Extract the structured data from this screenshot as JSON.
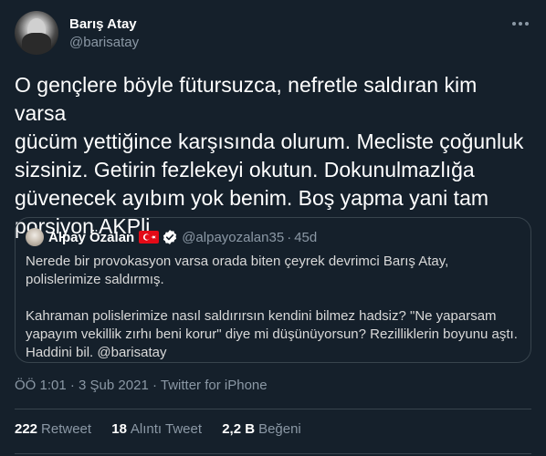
{
  "author": {
    "display_name": "Barış Atay",
    "handle": "@barisatay"
  },
  "tweet_text": "O gençlere böyle fütursuzca, nefretle saldıran kim varsa\ngücüm yettiğince karşısında olurum. Mecliste çoğunluk\nsizsiniz. Getirin fezlekeyi okutun. Dokunulmazlığa\ngüvenecek ayıbım yok benim. Boş yapma yani tam\nporsiyon AKPli",
  "quote": {
    "display_name": "Alpay Özalan",
    "handle": "@alpayozalan35",
    "separator": "·",
    "age": "45d",
    "paragraph1": "Nerede bir provokasyon varsa orada biten çeyrek devrimci Barış Atay, polislerimize saldırmış.",
    "paragraph2": "Kahraman polislerimize nasıl saldırırsın kendini bilmez hadsiz? \"Ne yaparsam yapayım vekillik zırhı beni korur\" diye mi düşünüyorsun? Rezilliklerin boyunu aştı. Haddini bil. @barisatay"
  },
  "meta": {
    "time": "ÖÖ 1:01",
    "separator": "·",
    "date": "3 Şub 2021",
    "source": "Twitter for iPhone"
  },
  "stats": {
    "retweets_count": "222",
    "retweets_label": "Retweet",
    "quotes_count": "18",
    "quotes_label": "Alıntı Tweet",
    "likes_count": "2,2 B",
    "likes_label": "Beğeni"
  },
  "colors": {
    "background": "#15202b",
    "border": "#38444d",
    "secondary_text": "#8b98a5",
    "verified": "#ffffff"
  },
  "icons": {
    "more": "more-dots-icon",
    "flag": "turkey-flag-icon",
    "verified": "verified-badge-icon"
  }
}
